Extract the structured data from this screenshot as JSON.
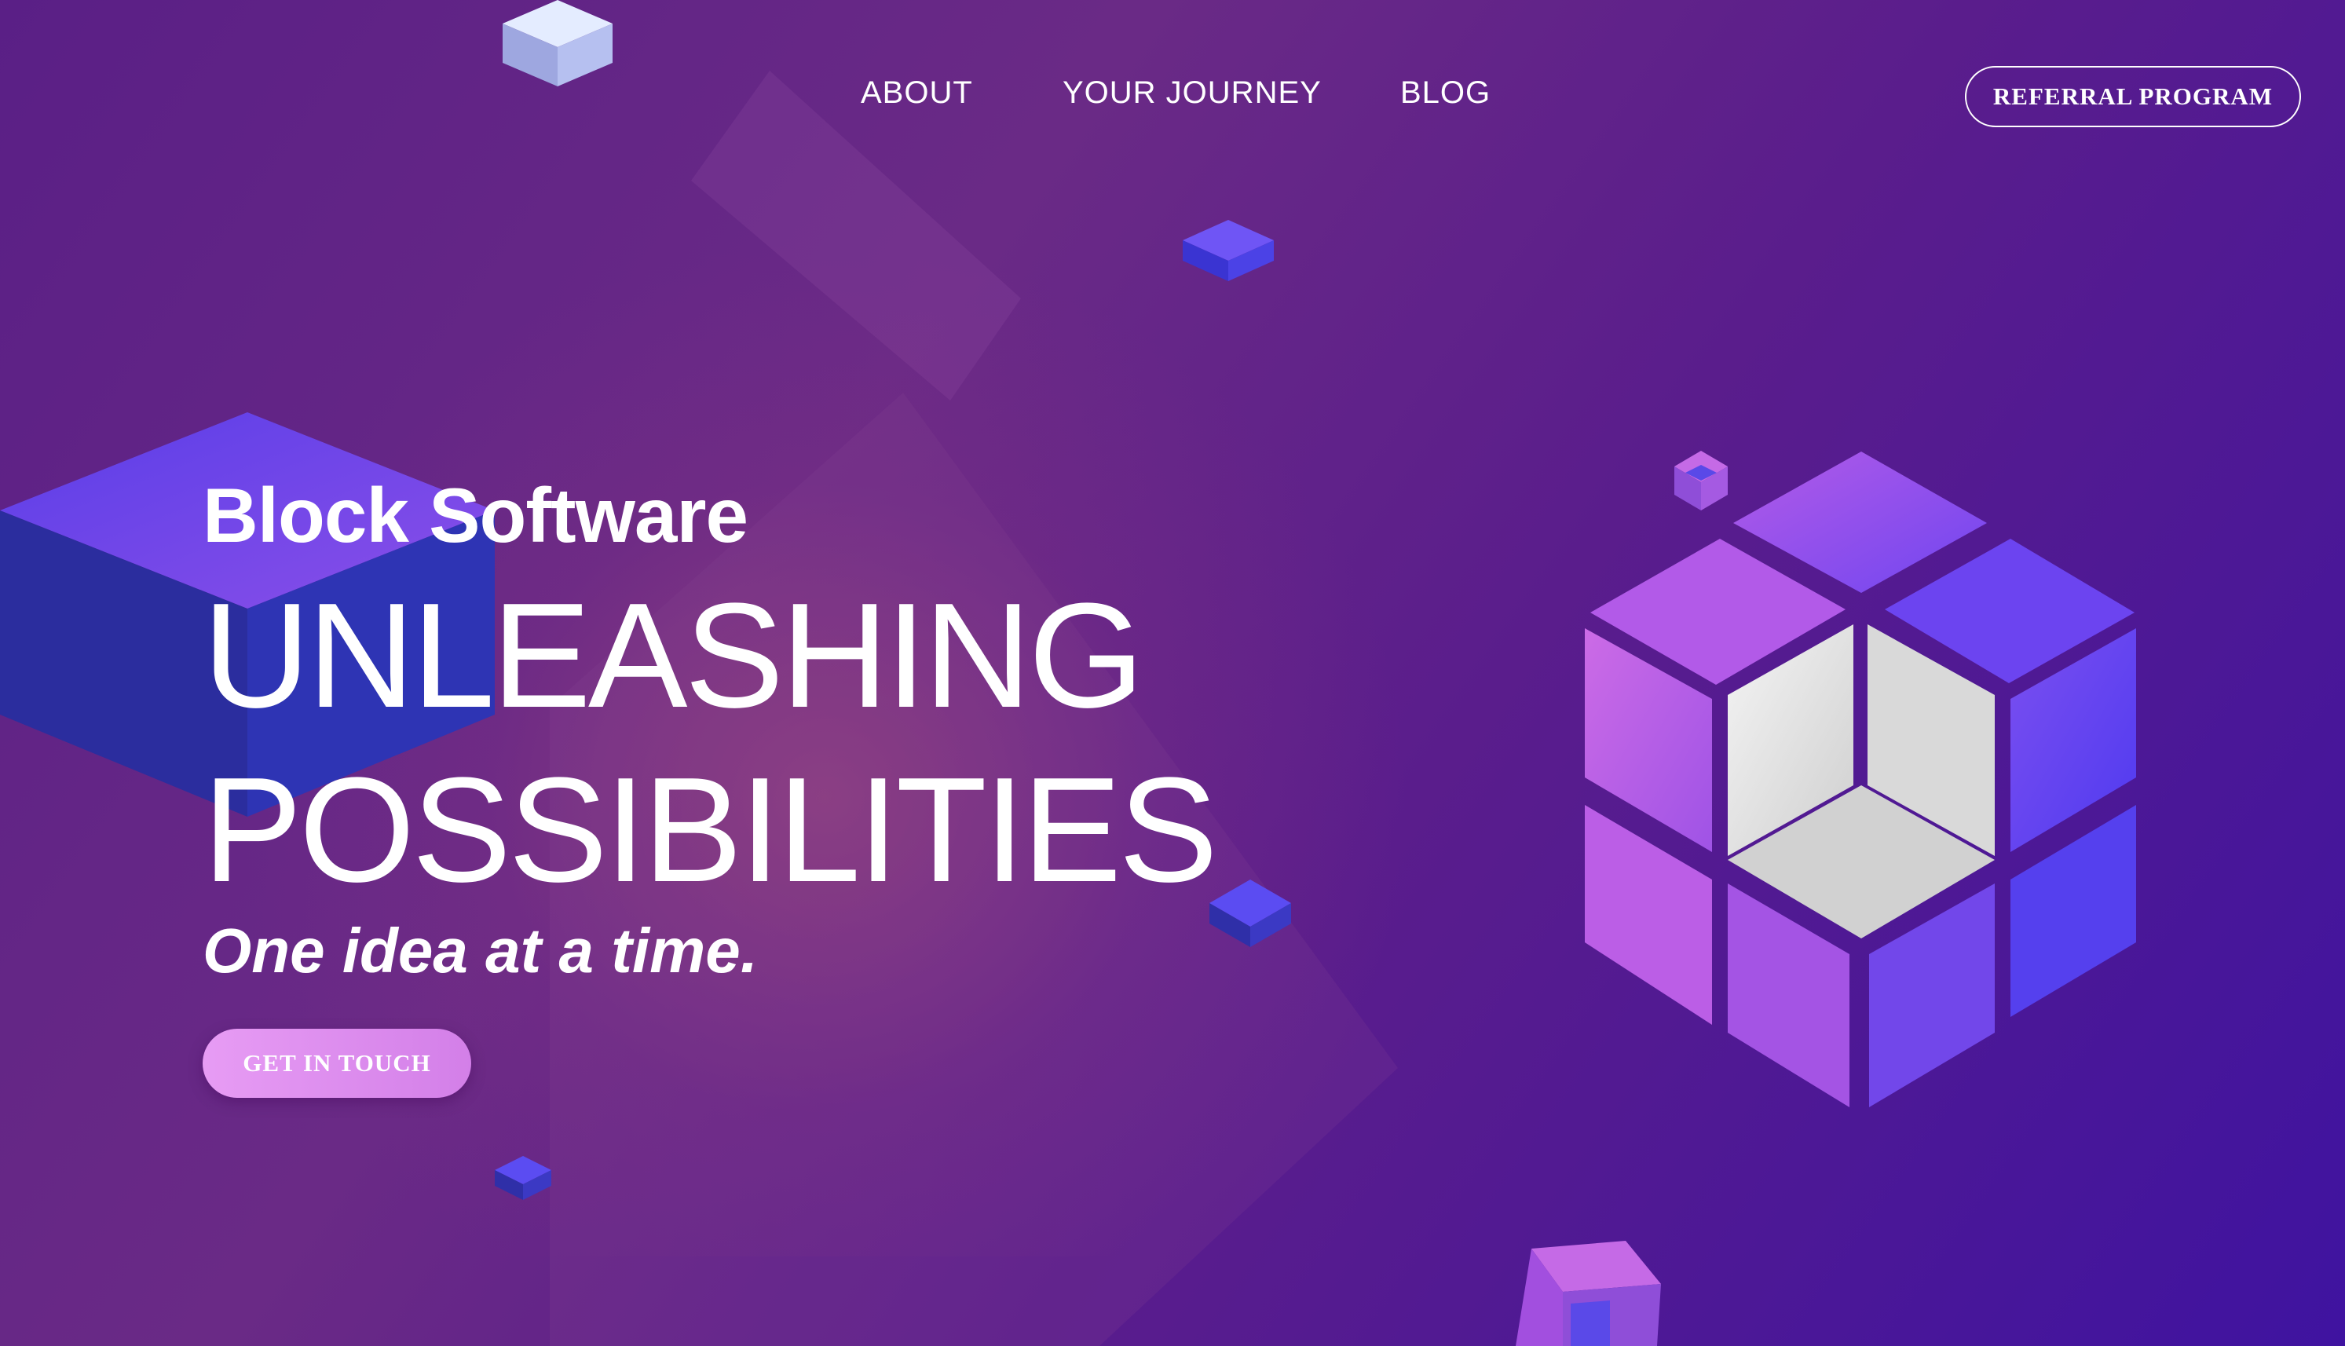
{
  "nav": {
    "links": [
      {
        "label": "ABOUT"
      },
      {
        "label": "YOUR JOURNEY"
      },
      {
        "label": "BLOG"
      }
    ],
    "referral_label": "REFERRAL PROGRAM"
  },
  "hero": {
    "brand": "Block Software",
    "headline_line1": "UNLEASHING",
    "headline_line2": "POSSIBILITIES",
    "tagline": "One idea at a time.",
    "cta_label": "GET IN TOUCH"
  },
  "colors": {
    "background_start": "#5a1f86",
    "background_end": "#3f13a0",
    "cta": "#e39af2",
    "text": "#ffffff"
  }
}
